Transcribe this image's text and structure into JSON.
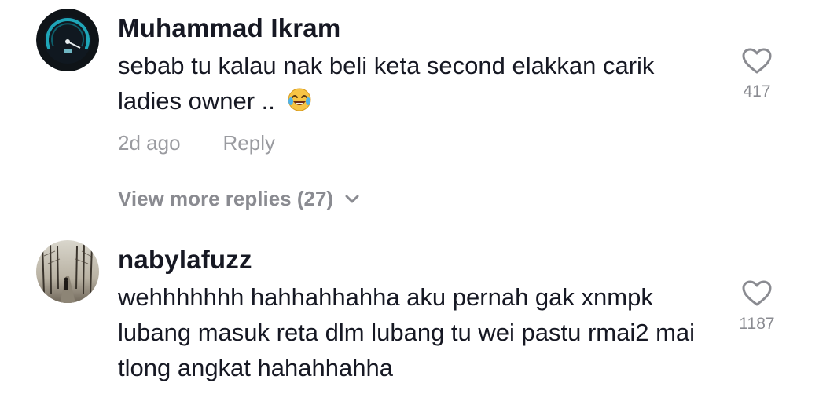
{
  "comments": [
    {
      "username": "Muhammad Ikram",
      "text": "sebab tu kalau nak beli keta second elakkan carik ladies owner .. ",
      "emoji": "face-with-tears-of-joy",
      "time": "2d ago",
      "reply_label": "Reply",
      "likes": "417",
      "avatar_icon": "speedometer-icon"
    },
    {
      "username": "nabylafuzz",
      "text": "wehhhhhhh hahhahhahha aku pernah gak xnmpk lubang masuk reta dlm lubang tu wei pastu rmai2 mai tlong angkat hahahhahha",
      "likes": "1187",
      "avatar_icon": "forest-road-photo"
    }
  ],
  "view_more_replies": "View more replies (27)",
  "colors": {
    "text": "#161823",
    "secondary": "#9a9ba0",
    "icon": "#8a8b91"
  }
}
